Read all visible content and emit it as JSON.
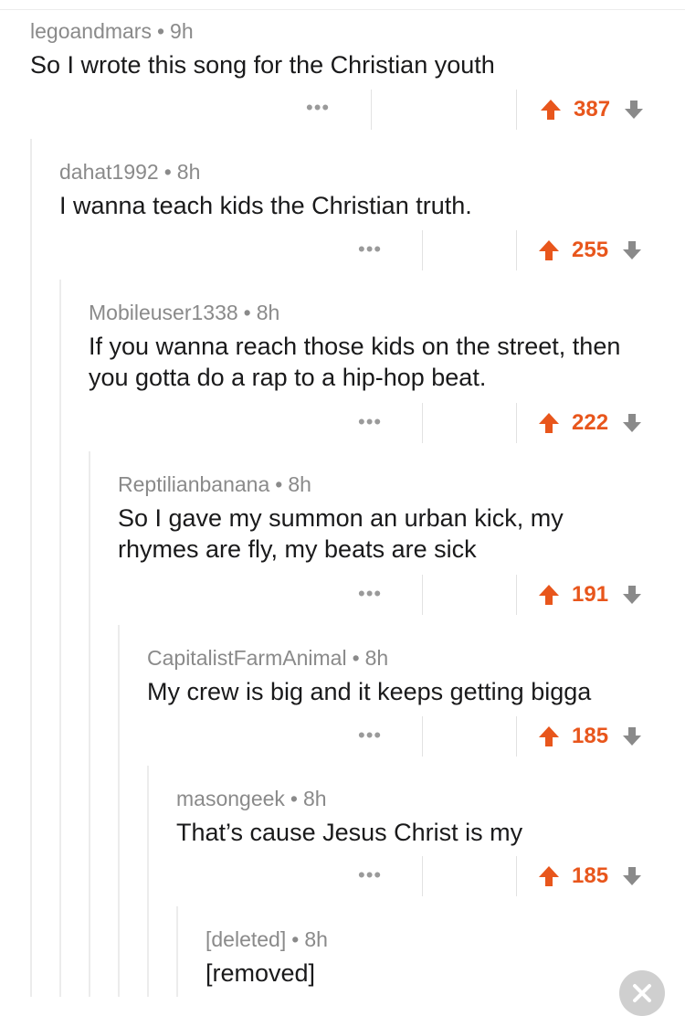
{
  "comments": [
    {
      "user": "legoandmars",
      "sep": "•",
      "age": "9h",
      "text": "So I wrote this song for the Christian youth",
      "more": "•••",
      "score": "387"
    },
    {
      "user": "dahat1992",
      "sep": "•",
      "age": "8h",
      "text": "I wanna teach kids the Christian truth.",
      "more": "•••",
      "score": "255"
    },
    {
      "user": "Mobileuser1338",
      "sep": "•",
      "age": "8h",
      "text": "If you wanna reach those kids on the street, then you gotta do a rap to a hip-hop beat.",
      "more": "•••",
      "score": "222"
    },
    {
      "user": "Reptilianbanana",
      "sep": "•",
      "age": "8h",
      "text": "So I gave my summon an urban kick, my rhymes are fly, my beats are sick",
      "more": "•••",
      "score": "191"
    },
    {
      "user": "CapitalistFarmAnimal",
      "sep": "•",
      "age": "8h",
      "text": "My crew is big and it keeps getting bigga",
      "more": "•••",
      "score": "185"
    },
    {
      "user": "masongeek",
      "sep": "•",
      "age": "8h",
      "text": "That’s cause Jesus Christ is my",
      "more": "•••",
      "score": "185"
    },
    {
      "user": "[deleted]",
      "sep": "•",
      "age": "8h",
      "text": "[removed]"
    }
  ],
  "colors": {
    "upvote": "#e8561c",
    "downvote": "#8a8a8a",
    "meta": "#8a8a8a",
    "thread": "#ececec"
  },
  "icons": {
    "upvote": "arrow-up-icon",
    "downvote": "arrow-down-icon",
    "more": "more-dots-icon",
    "close": "close-icon"
  }
}
